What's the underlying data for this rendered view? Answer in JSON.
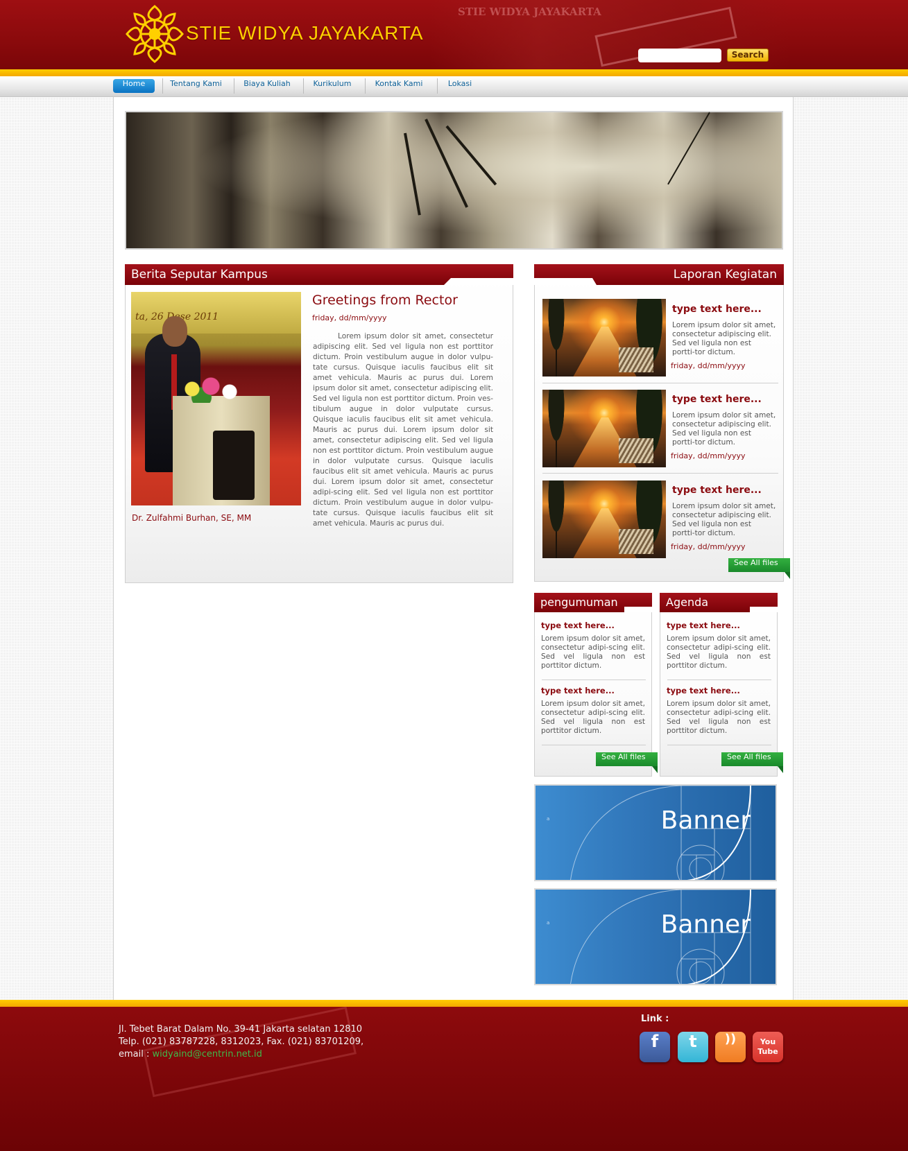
{
  "header": {
    "site_title": "STIE WIDYA JAYAKARTA",
    "search_placeholder": "",
    "search_button": "Search"
  },
  "nav": {
    "items": [
      {
        "label": "Home",
        "active": true
      },
      {
        "label": "Tentang Kami"
      },
      {
        "label": "Biaya Kuliah"
      },
      {
        "label": "Kurikulum"
      },
      {
        "label": "Kontak Kami"
      },
      {
        "label": "Lokasi"
      }
    ]
  },
  "news": {
    "title": "Berita Seputar Kampus",
    "headline": "Greetings from Rector",
    "date": "friday, dd/mm/yyyy",
    "photo_caption": "Dr. Zulfahmi Burhan, SE, MM",
    "photo_banner_text": "ta, 26 Dese 2011",
    "body": "Lorem ipsum dolor sit amet, consectetur adipiscing elit. Sed vel ligula non est porttitor dictum. Proin vestibulum augue in dolor vulpu-tate cursus. Quisque iaculis faucibus elit sit amet vehicula. Mauris ac purus dui. Lorem ipsum dolor sit amet, consectetur adipiscing elit. Sed vel ligula non est porttitor dictum. Proin ves-tibulum augue in dolor vulputate cursus. Quisque iaculis faucibus elit sit amet vehicula. Mauris ac purus dui. Lorem ipsum dolor sit amet, consectetur adipiscing elit. Sed vel ligula non est porttitor dictum. Proin vestibulum augue in dolor vulputate cursus. Quisque iaculis faucibus elit sit amet vehicula. Mauris ac purus dui. Lorem ipsum dolor sit amet, consectetur adipi-scing elit. Sed vel ligula non est porttitor dictum. Proin vestibulum augue in dolor vulpu-tate cursus. Quisque iaculis faucibus elit sit amet vehicula. Mauris ac purus dui."
  },
  "activities": {
    "title": "Laporan Kegiatan",
    "items": [
      {
        "heading": "type text here...",
        "text": "Lorem ipsum dolor sit amet, consectetur adipiscing elit. Sed vel ligula non est portti-tor dictum.",
        "date": "friday, dd/mm/yyyy"
      },
      {
        "heading": "type text here...",
        "text": "Lorem ipsum dolor sit amet, consectetur adipiscing elit. Sed vel ligula non est portti-tor dictum.",
        "date": "friday, dd/mm/yyyy"
      },
      {
        "heading": "type text here...",
        "text": "Lorem ipsum dolor sit amet, consectetur adipiscing elit. Sed vel ligula non est portti-tor dictum.",
        "date": "friday, dd/mm/yyyy"
      }
    ],
    "see_all": "See All files"
  },
  "announcements": {
    "title": "pengumuman",
    "items": [
      {
        "heading": "type text here...",
        "text": "Lorem ipsum dolor sit amet, consectetur adipi-scing elit. Sed vel ligula non est porttitor dictum."
      },
      {
        "heading": "type text here...",
        "text": "Lorem ipsum dolor sit amet, consectetur adipi-scing elit. Sed vel ligula non est porttitor dictum."
      }
    ],
    "see_all": "See All files"
  },
  "agenda": {
    "title": "Agenda",
    "items": [
      {
        "heading": "type text here...",
        "text": "Lorem ipsum dolor sit amet, consectetur adipi-scing elit. Sed vel ligula non est porttitor dictum."
      },
      {
        "heading": "type text here...",
        "text": "Lorem ipsum dolor sit amet, consectetur adipi-scing elit. Sed vel ligula non est porttitor dictum."
      }
    ],
    "see_all": "See All files"
  },
  "banners": [
    {
      "label": "Banner",
      "mark": "a"
    },
    {
      "label": "Banner",
      "mark": "a"
    }
  ],
  "footer": {
    "address": "Jl. Tebet Barat Dalam No. 39-41 Jakarta selatan 12810",
    "phone": "Telp. (021) 83787228, 8312023, Fax. (021) 83701209,",
    "email_label": "email : ",
    "email": "widyaind@centrin.net.id",
    "links_label": "Link :",
    "social": [
      {
        "icon": "facebook-icon",
        "glyph": "f",
        "color": "#3b5998"
      },
      {
        "icon": "twitter-icon",
        "glyph": "t",
        "color": "#33b5d6"
      },
      {
        "icon": "rss-icon",
        "glyph": "))",
        "color": "#f07c22"
      },
      {
        "icon": "youtube-icon",
        "glyph": "You Tube",
        "color": "#d8332b"
      }
    ]
  },
  "colors": {
    "brand_red": "#8b0b10",
    "gold": "#ffd000",
    "green_button": "#1a8a2c",
    "nav_active": "#0a73c2"
  }
}
